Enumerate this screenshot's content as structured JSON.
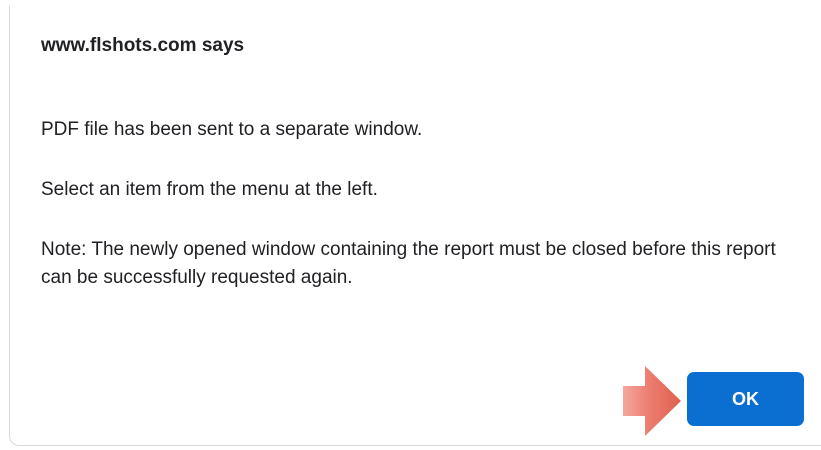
{
  "dialog": {
    "title": "www.flshots.com says",
    "messages": [
      "PDF file has been sent to a separate window.",
      "Select an item from the menu at the left.",
      "Note: The newly opened window containing the report must be closed before this report can be successfully requested again."
    ],
    "ok_label": "OK"
  },
  "colors": {
    "ok_button": "#0b6fd1",
    "arrow": "#e8685a"
  },
  "icons": {
    "pointer": "arrow-right-icon"
  }
}
